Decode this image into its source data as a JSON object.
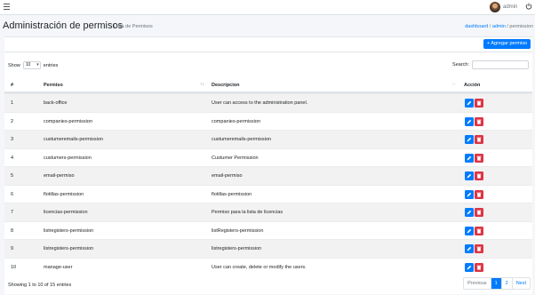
{
  "topbar": {
    "username": "admin"
  },
  "header": {
    "title": "Administración de permisos",
    "subtitle": "Lista de Permisos",
    "breadcrumb": [
      "dashboard",
      "admin",
      "permission"
    ]
  },
  "toolbar": {
    "add_label": "+ Agregar permiso"
  },
  "table_controls": {
    "show_label": "Show",
    "entries_value": "10",
    "entries_label": "entries",
    "search_label": "Search:",
    "search_value": ""
  },
  "columns": [
    "#",
    "Permiso",
    "Descripcion",
    "Acción"
  ],
  "rows": [
    {
      "num": "1",
      "permiso": "back-office",
      "descripcion": "User can access to the administration panel."
    },
    {
      "num": "2",
      "permiso": "companies-permission",
      "descripcion": "companies-permission"
    },
    {
      "num": "3",
      "permiso": "custumeremails-permission",
      "descripcion": "custumeremails-permission"
    },
    {
      "num": "4",
      "permiso": "custumers-permission",
      "descripcion": "Custumer Permission"
    },
    {
      "num": "5",
      "permiso": "email-permiso",
      "descripcion": "email-permiso"
    },
    {
      "num": "6",
      "permiso": "flotillas-permission",
      "descripcion": "flotillas-permission"
    },
    {
      "num": "7",
      "permiso": "licencias-permission",
      "descripcion": "Permiso para la lista de licencias"
    },
    {
      "num": "8",
      "permiso": "listregisters-permission",
      "descripcion": "listRegisters-permission"
    },
    {
      "num": "9",
      "permiso": "listregisters-permission",
      "descripcion": "listregisters-permission"
    },
    {
      "num": "10",
      "permiso": "manage-user",
      "descripcion": "User can create, delete or modify the users."
    }
  ],
  "footer": {
    "info": "Showing 1 to 10 of 15 entries",
    "pages": [
      "Previous",
      "1",
      "2",
      "Next"
    ],
    "active_page": "1"
  },
  "colors": {
    "primary": "#007bff",
    "danger": "#dc3545",
    "background": "#f4f6f9"
  },
  "icons": {
    "menu": "hamburger-icon",
    "power": "power-icon",
    "edit": "pencil-icon",
    "delete": "trash-icon",
    "sort": "sort-icon"
  }
}
